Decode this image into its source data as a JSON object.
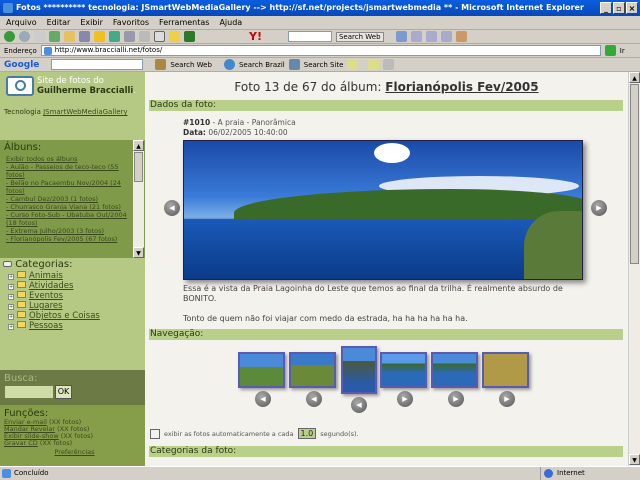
{
  "window": {
    "title": "Fotos ********** tecnologia: JSmartWebMediaGallery --> http://sf.net/projects/jsmartwebmedia ** - Microsoft Internet Explorer"
  },
  "menu": [
    "Arquivo",
    "Editar",
    "Exibir",
    "Favoritos",
    "Ferramentas",
    "Ajuda"
  ],
  "toolbar": {
    "search_web": "Search Web"
  },
  "address": {
    "label": "Endereço",
    "url": "http://www.braccialli.net/fotos/",
    "go": "Ir"
  },
  "google_bar": {
    "logo": "Google",
    "search_web": "Search Web",
    "search_brazil": "Search Brazil",
    "search_site": "Search Site"
  },
  "sidebar": {
    "site_line1": "Site de fotos do",
    "site_line2": "Guilherme Braccialli",
    "tech_label": "Tecnologia",
    "tech_link": "JSmartWebMediaGallery",
    "albums_title": "Álbuns:",
    "albums_all": "Exibir todos os álbuns",
    "albums": [
      "- Aulão - Passeios de teco-teco (55 fotos)",
      "- Belão no Pacaembu Nov/2004 (24 fotos)",
      "- Cambuí Dez/2003 (1 fotos)",
      "- Churrasco Granja Viana (21 fotos)",
      "- Curso Foto-Sub - Ubatuba Out/2004 (18 fotos)",
      "- Extrema Julho/2003 (3 fotos)",
      "- Florianópolis Fev/2005 (67 fotos)"
    ],
    "categories_title": "Categorias:",
    "categories": [
      "Animais",
      "Atividades",
      "Eventos",
      "Lugares",
      "Objetos e Coisas",
      "Pessoas"
    ],
    "search_title": "Busca:",
    "search_ok": "OK",
    "functions_title": "Funções:",
    "functions": [
      {
        "link": "Enviar e-mail",
        "count": "(XX fotos)"
      },
      {
        "link": "Mandar Revelar",
        "count": "(XX fotos)"
      },
      {
        "link": "Exibir slide-show",
        "count": "(XX fotos)"
      },
      {
        "link": "Gravar CD",
        "count": "(XX fotos)"
      }
    ],
    "preferences": "Preferências"
  },
  "main": {
    "heading_prefix": "Foto 13 de 67 do álbum:",
    "album_link": "Florianópolis Fev/2005",
    "section_data": "Dados da foto:",
    "photo_id": "#1010",
    "photo_title": " - A praia - Panorâmica",
    "date_label": "Data:",
    "date_value": " 06/02/2005 10:40:00",
    "description1": "Essa é a vista da Praia Lagoinha do Leste que temos ao final da trilha. É realmente absurdo de BONITO.",
    "description2": "Tonto de quem não foi viajar com medo da estrada, ha ha ha ha ha ha.",
    "section_nav": "Navegação:",
    "autoplay_label": "exibir as fotos automaticamente a cada",
    "autoplay_value": "1.0",
    "autoplay_unit": "segundo(s).",
    "section_categories": "Categorias da foto:"
  },
  "status": {
    "text": "Concluído",
    "zone": "Internet"
  }
}
